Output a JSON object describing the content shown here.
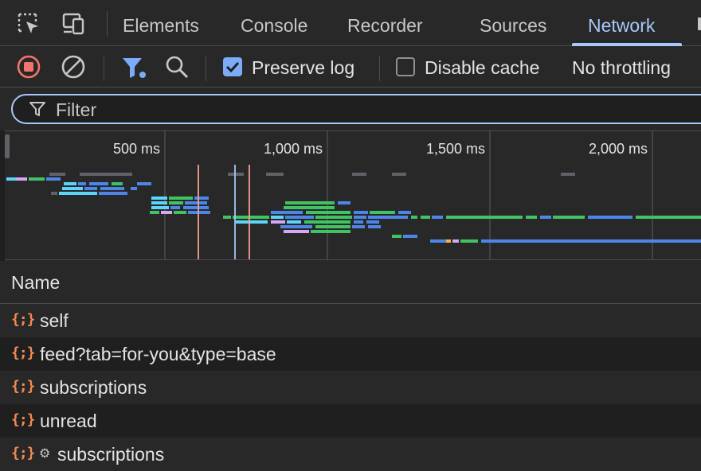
{
  "tabs": [
    {
      "label": "Elements",
      "active": false
    },
    {
      "label": "Console",
      "active": false
    },
    {
      "label": "Recorder",
      "active": false
    },
    {
      "label": "Sources",
      "active": false
    },
    {
      "label": "Network",
      "active": true
    }
  ],
  "toolbar": {
    "record_icon": "record-stop-icon",
    "clear_icon": "clear-icon",
    "filter_icon": "filter-icon",
    "search_icon": "search-icon",
    "preserve_log": {
      "label": "Preserve log",
      "checked": true
    },
    "disable_cache": {
      "label": "Disable cache",
      "checked": false
    },
    "throttling": "No throttling"
  },
  "filter": {
    "placeholder": "Filter",
    "value": ""
  },
  "overview": {
    "ticks": [
      "500 ms",
      "1,000 ms",
      "1,500 ms",
      "2,000 ms"
    ]
  },
  "table": {
    "header": "Name",
    "rows": [
      {
        "name": "self",
        "icon": "json-icon",
        "gear": false
      },
      {
        "name": "feed?tab=for-you&type=base",
        "icon": "json-icon",
        "gear": false
      },
      {
        "name": "subscriptions",
        "icon": "json-icon",
        "gear": false
      },
      {
        "name": "unread",
        "icon": "json-icon",
        "gear": false
      },
      {
        "name": "subscriptions",
        "icon": "json-icon",
        "gear": true
      }
    ]
  },
  "colors": {
    "accent": "#a8c7fa",
    "record": "#f2756b",
    "json_icon": "#f28b54",
    "checkbox": "#7cacf8"
  }
}
